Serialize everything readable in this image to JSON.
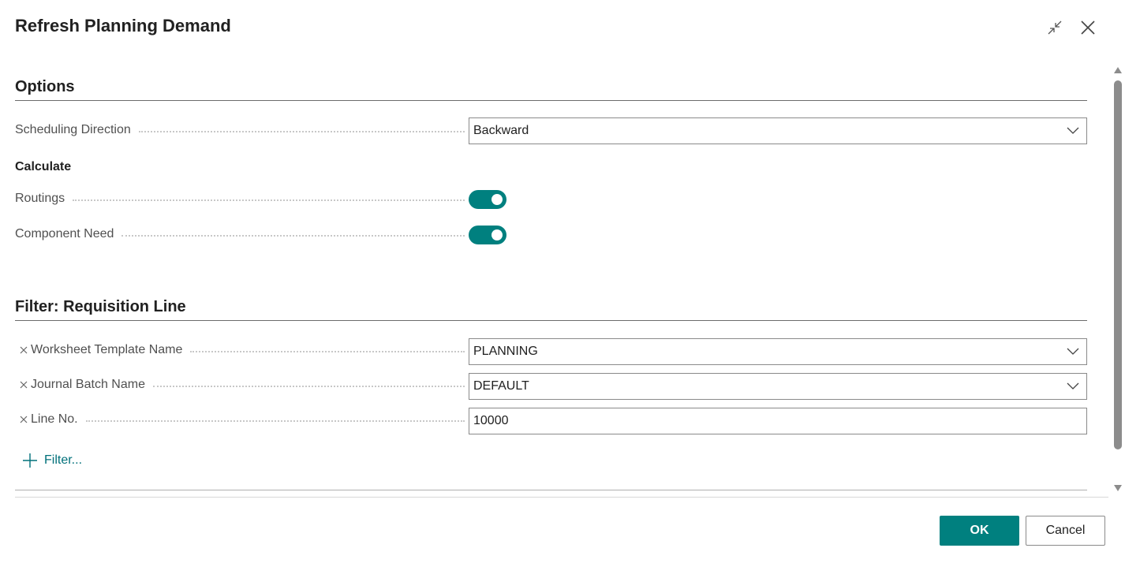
{
  "dialog": {
    "title": "Refresh Planning Demand"
  },
  "options": {
    "section_title": "Options",
    "scheduling_direction": {
      "label": "Scheduling Direction",
      "value": "Backward"
    },
    "calculate_label": "Calculate",
    "routings": {
      "label": "Routings",
      "on": true
    },
    "component_need": {
      "label": "Component Need",
      "on": true
    }
  },
  "filter": {
    "section_title": "Filter: Requisition Line",
    "worksheet_template": {
      "label": "Worksheet Template Name",
      "value": "PLANNING"
    },
    "journal_batch": {
      "label": "Journal Batch Name",
      "value": "DEFAULT"
    },
    "line_no": {
      "label": "Line No.",
      "value": "10000"
    },
    "add_filter_label": "Filter..."
  },
  "footer": {
    "ok_label": "OK",
    "cancel_label": "Cancel"
  },
  "colors": {
    "accent": "#00807f",
    "link": "#00707a"
  }
}
